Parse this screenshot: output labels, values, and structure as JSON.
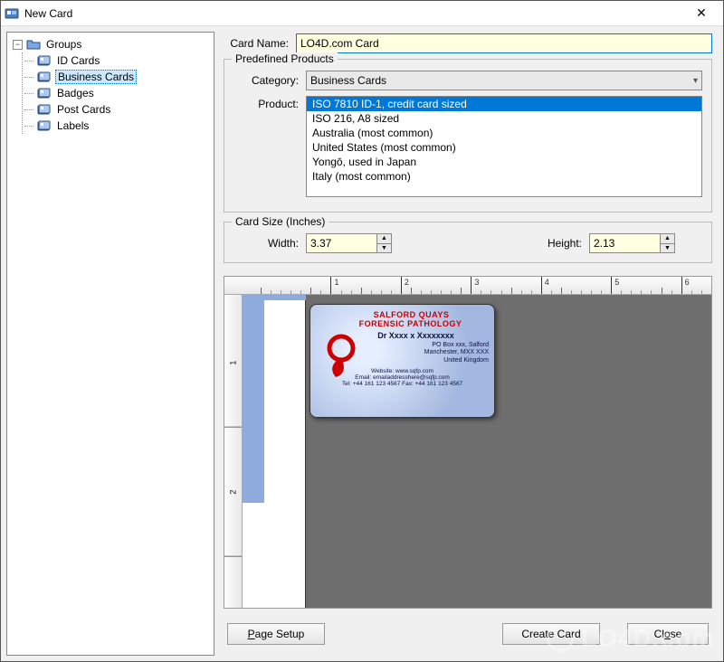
{
  "window": {
    "title": "New Card"
  },
  "tree": {
    "root": "Groups",
    "items": [
      {
        "label": "ID Cards"
      },
      {
        "label": "Business Cards",
        "selected": true
      },
      {
        "label": "Badges"
      },
      {
        "label": "Post Cards"
      },
      {
        "label": "Labels"
      }
    ]
  },
  "form": {
    "card_name_label": "Card Name:",
    "card_name_value": "LO4D.com Card",
    "predefined_legend": "Predefined Products",
    "category_label": "Category:",
    "category_value": "Business Cards",
    "product_label": "Product:",
    "products": [
      "ISO 7810 ID-1, credit card sized",
      "ISO 216, A8 sized",
      "Australia (most common)",
      "United States (most common)",
      "Yongō, used in Japan",
      "Italy (most common)"
    ],
    "product_selected": 0,
    "size_legend": "Card Size (Inches)",
    "width_label": "Width:",
    "width_value": "3.37",
    "height_label": "Height:",
    "height_value": "2.13"
  },
  "preview": {
    "brand1": "SALFORD QUAYS",
    "brand2": "FORENSIC PATHOLOGY",
    "name": "Dr Xxxx x Xxxxxxxx",
    "addr1": "PO Box xxx, Salford",
    "addr2": "Manchester, MXX XXX",
    "addr3": "United Kingdom",
    "web": "Website:  www.sqfp.com",
    "email": "Email:  emailaddresshere@sqfp.com",
    "telfax": "Tel: +44 161 123 4567    Fax: +44 161 123 4567"
  },
  "ruler": {
    "numbers": [
      "1",
      "2",
      "3",
      "4",
      "5",
      "6"
    ],
    "v": [
      "1",
      "2"
    ]
  },
  "buttons": {
    "page_setup": "Page Setup",
    "create": "Create Card",
    "close": "Close"
  },
  "branding": "LO4D.com"
}
